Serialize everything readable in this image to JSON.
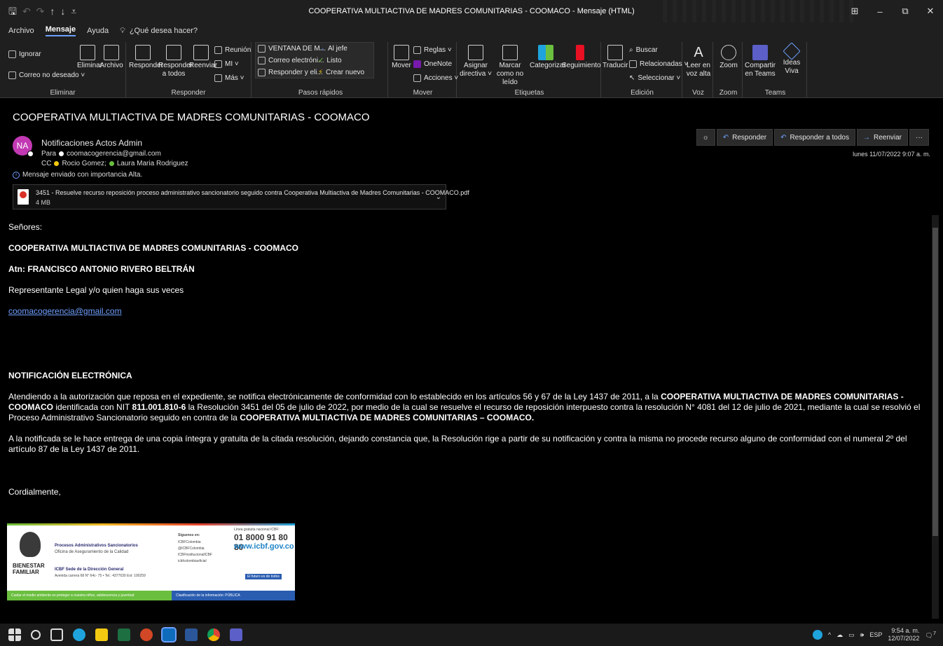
{
  "window": {
    "title": "COOPERATIVA MULTIACTIVA DE MADRES COMUNITARIAS - COOMACO  -  Mensaje (HTML)",
    "controls": {
      "ribbon_display": "⊞",
      "minimize": "–",
      "restore": "⧉",
      "close": "✕"
    }
  },
  "qat": {
    "save": "🖫",
    "undo": "↶",
    "redo": "↷",
    "up": "↑",
    "down": "↓",
    "customize": "⩡"
  },
  "menu": {
    "archivo": "Archivo",
    "mensaje": "Mensaje",
    "ayuda": "Ayuda",
    "tell_me": "¿Qué desea hacer?"
  },
  "ribbon": {
    "eliminar": {
      "label": "Eliminar",
      "ignorar": "Ignorar",
      "correo_no_deseado": "Correo no deseado ˅",
      "eliminar_btn": "Eliminar",
      "archivo_btn": "Archivo"
    },
    "responder": {
      "label": "Responder",
      "responder": "Responder",
      "responder_todos": "Responder a todos",
      "reenviar": "Reenviar",
      "reunion": "Reunión",
      "mi": "MI ˅",
      "mas": "Más ˅"
    },
    "pasos": {
      "label": "Pasos rápidos",
      "items": [
        "VENTANA DE M...",
        "Correo electróni...",
        "Responder y eli...",
        "Al jefe",
        "Listo",
        "Crear nuevo"
      ]
    },
    "mover": {
      "label": "Mover",
      "mover": "Mover",
      "reglas": "Reglas ˅",
      "onenote": "OneNote",
      "acciones": "Acciones ˅"
    },
    "etiquetas": {
      "label": "Etiquetas",
      "asignar": "Asignar directiva ˅",
      "marcar": "Marcar como no leído",
      "categorizar": "Categorizar",
      "seguimiento": "Seguimiento"
    },
    "edicion": {
      "label": "Edición",
      "traducir": "Traducir",
      "buscar": "Buscar",
      "relacionadas": "Relacionadas ˅",
      "seleccionar": "Seleccionar ˅"
    },
    "voz": {
      "label": "Voz",
      "leer": "Leer en voz alta"
    },
    "zoom": {
      "label": "Zoom",
      "zoom": "Zoom"
    },
    "teams": {
      "label": "Teams",
      "compartir": "Compartir en Teams",
      "ideas": "Ideas Viva"
    }
  },
  "message": {
    "subject": "COOPERATIVA MULTIACTIVA DE MADRES COMUNITARIAS - COOMACO",
    "avatar_initials": "NA",
    "sender": "Notificaciones Actos Admin",
    "to_label": "Para",
    "to": "coomacogerencia@gmail.com",
    "cc_label": "CC",
    "cc1": "Rocio Gomez;",
    "cc2": "Laura Maria Rodriguez",
    "importance": "Mensaje enviado con importancia Alta.",
    "date": "lunes 11/07/2022 9:07 a. m.",
    "actions": {
      "responder": "Responder",
      "responder_todos": "Responder a todos",
      "reenviar": "Reenviar",
      "more": "···"
    },
    "attachment": {
      "name": "3451 - Resuelve recurso reposición proceso administrativo sancionatorio seguido contra Cooperativa Multiactiva de Madres Comunitarias - COOMACO.pdf",
      "size": "4 MB"
    }
  },
  "body": {
    "greeting": "Señores:",
    "company": "COOPERATIVA MULTIACTIVA DE MADRES COMUNITARIAS - COOMACO",
    "atn": "Atn: FRANCISCO ANTONIO RIVERO BELTRÁN",
    "rep": "Representante Legal y/o quien haga sus veces",
    "email_link": "coomacogerencia@gmail.com",
    "heading": "NOTIFICACIÓN ELECTRÓNICA",
    "p1_a": "Atendiendo a la autorización que reposa en el expediente, se notifica electrónicamente de conformidad con lo establecido en los artículos 56 y 67 de la Ley 1437 de 2011, a la ",
    "p1_b": "COOPERATIVA MULTIACTIVA DE MADRES COMUNITARIAS - COOMACO",
    "p1_c": "  identificada con NIT ",
    "p1_d": "811.001.810-6",
    "p1_e": " la Resolución 3451 del 05 de julio de 2022, por medio de la cual se resuelve el recurso de reposición  interpuesto contra la resolución N° 4081 del 12 de julio de 2021, mediante la cual se resolvió el Proceso Administrativo Sancionatorio seguido en contra de la ",
    "p1_f": "COOPERATIVA MULTIACTIVA DE MADRES COMUNITARIAS – COOMACO.",
    "p2": "A la notificada se le hace entrega de una copia íntegra y gratuita de la citada resolución, dejando constancia que, la Resolución rige a partir de su notificación y contra la misma no procede recurso alguno de conformidad con el numeral 2º del artículo 87 de la Ley 1437 de 2011.",
    "closing": "Cordialmente,"
  },
  "signature": {
    "org1": "BIENESTAR",
    "org2": "FAMILIAR",
    "title": "Procesos Administrativos Sancionatorios",
    "subtitle": "Oficina de Aseguramiento de la Calidad",
    "sede": "ICBF Sede de la Dirección General",
    "address": "Avenida carrera 68 N° 64c- 75 • Tel.: 4377630 Ext: 100259",
    "siguenos": "Síguenos en:",
    "social": [
      "ICBFColombia",
      "@ICBFColombia",
      "ICBFinstitucionalICBF",
      "icbfcolombiaoficial"
    ],
    "linea": "Línea gratuita nacional ICBF:",
    "phone": "01 8000 91 80 80",
    "url": "www.icbf.gov.co",
    "futuro": "El futuro es de todos",
    "green_bar": "Cuidar el medio ambiente es proteger a nuestra niñez, adolescencia y juventud",
    "blue_bar": "Clasificación de la información: PÚBLICA"
  },
  "taskbar": {
    "lang": "ESP",
    "time": "9:54 a. m.",
    "date": "12/07/2022",
    "notif_count": "7"
  },
  "colors": {
    "accent": "#6ea0ff",
    "avatar": "#c239b3",
    "ribbon_bg": "#1f1f1f",
    "pane_bg": "#000000"
  }
}
